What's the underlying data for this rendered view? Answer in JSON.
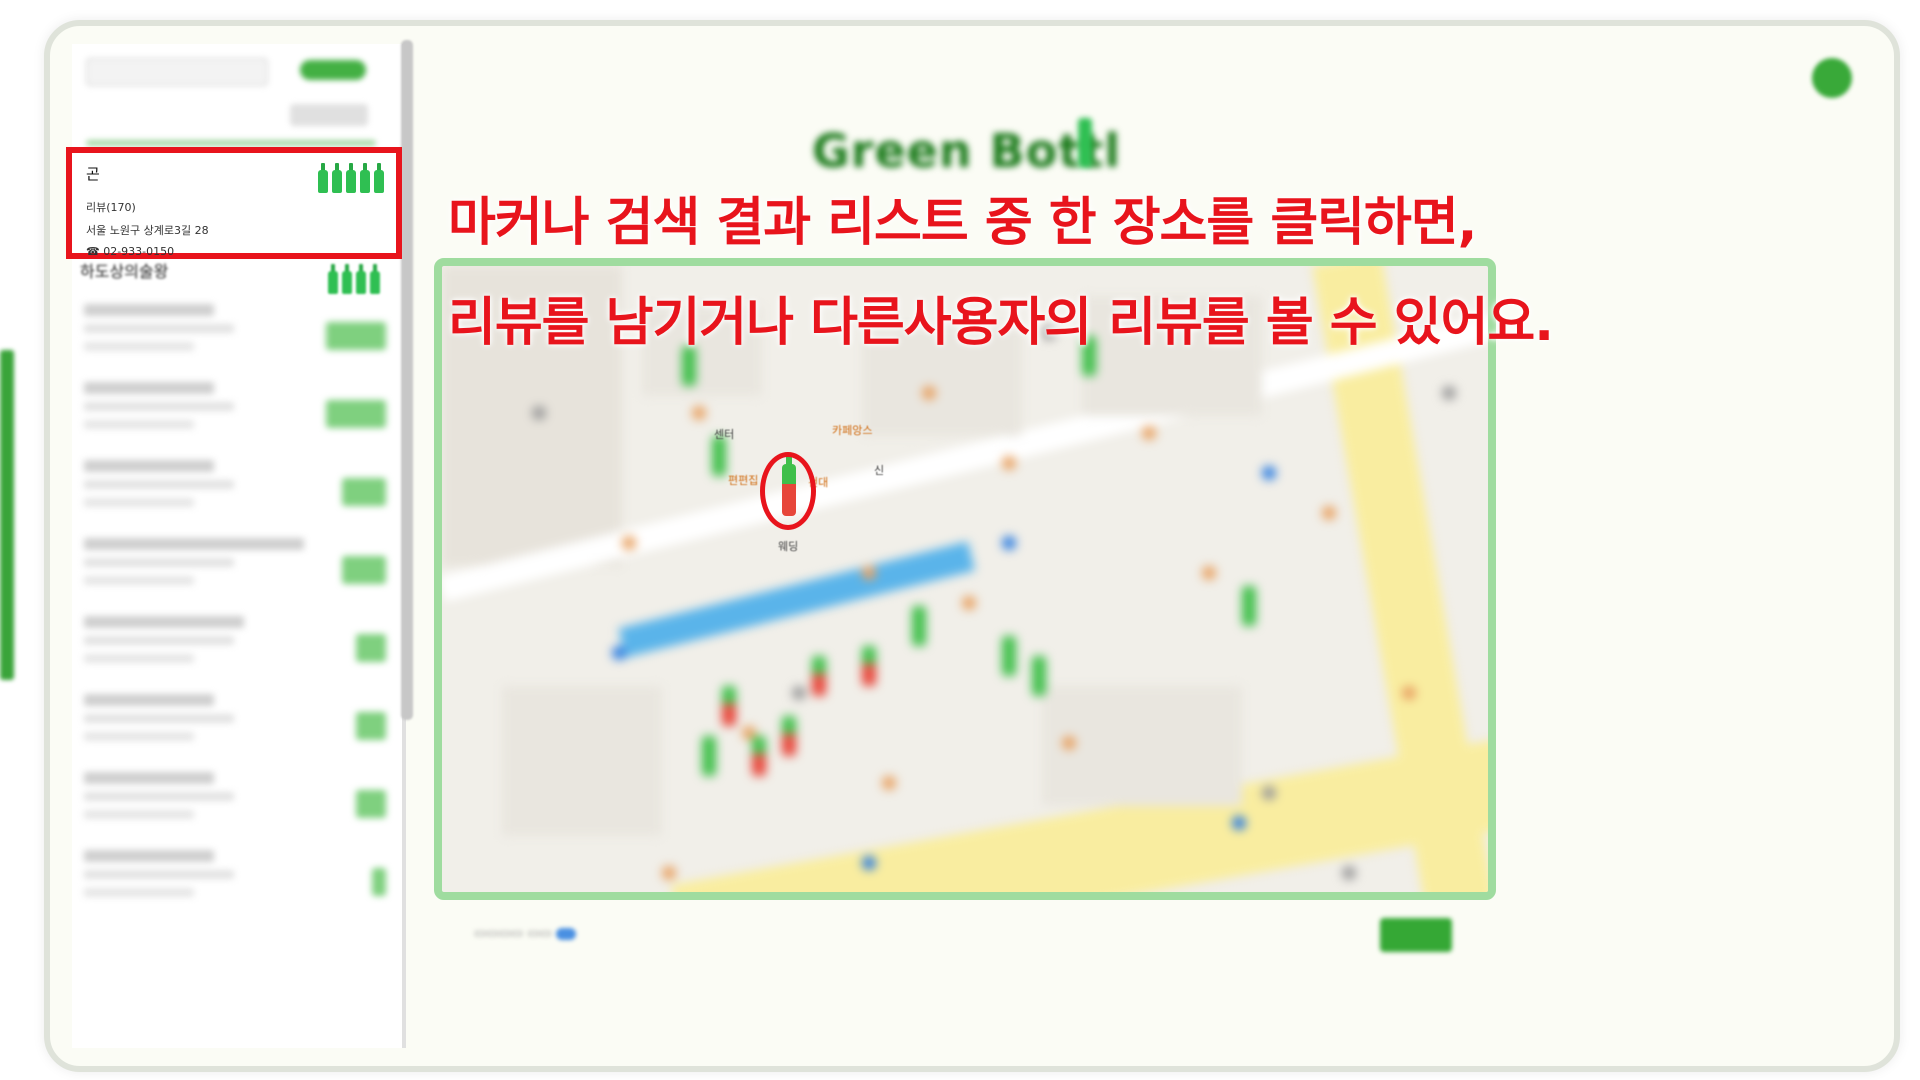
{
  "caption": {
    "line1": "마커나 검색 결과 리스트 중 한 장소를 클릭하면,",
    "line2": "리뷰를 남기거나 다른사용자의 리뷰를 볼 수 있어요."
  },
  "logo": {
    "text": "Green Bottl"
  },
  "selected_place": {
    "name": "곤",
    "reviews": "리뷰(170)",
    "address": "서울 노원구 상계로3길 28",
    "phone": "☎ 02-933-0150",
    "rating_bottles": 5
  },
  "next_place": {
    "name": "하도상의술왕",
    "rating_bottles": 4
  },
  "map": {
    "labels": [
      "센터",
      "카페앙스",
      "편편집",
      "건대",
      "웨딩",
      "신"
    ]
  },
  "colors": {
    "highlight": "#e8141c",
    "brand_green": "#3aa43a",
    "map_border": "#9fdc9f"
  }
}
